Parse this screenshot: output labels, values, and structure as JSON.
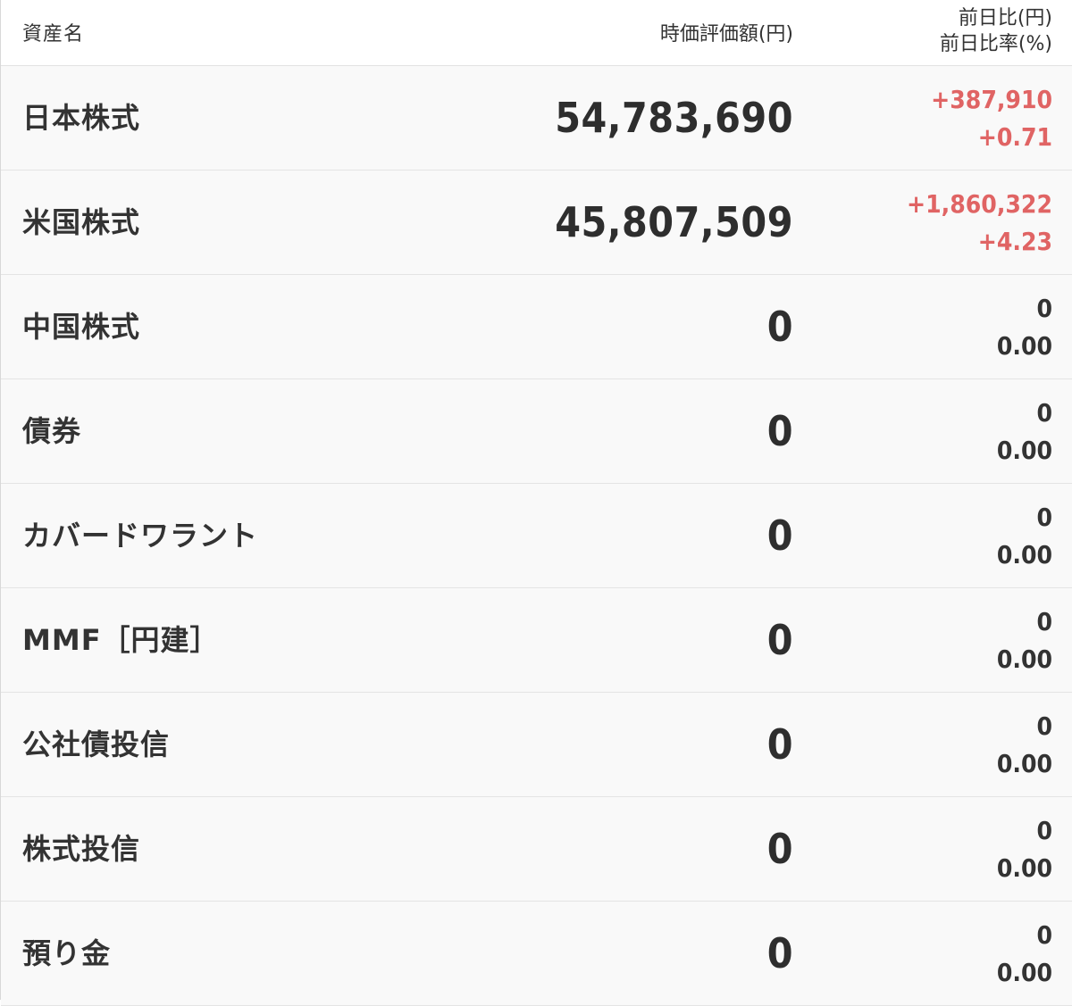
{
  "header": {
    "asset_name": "資産名",
    "market_value": "時価評価額(円)",
    "change_yen": "前日比(円)",
    "change_rate": "前日比率(%)"
  },
  "colors": {
    "positive": "#e06464",
    "neutral": "#333333",
    "row_bg": "#f9f9f9"
  },
  "rows": [
    {
      "name": "日本株式",
      "value": "54,783,690",
      "change": "+387,910",
      "rate": "+0.71",
      "trend": "pos"
    },
    {
      "name": "米国株式",
      "value": "45,807,509",
      "change": "+1,860,322",
      "rate": "+4.23",
      "trend": "pos"
    },
    {
      "name": "中国株式",
      "value": "0",
      "change": "0",
      "rate": "0.00",
      "trend": "flat"
    },
    {
      "name": "債券",
      "value": "0",
      "change": "0",
      "rate": "0.00",
      "trend": "flat"
    },
    {
      "name": "カバードワラント",
      "value": "0",
      "change": "0",
      "rate": "0.00",
      "trend": "flat"
    },
    {
      "name": "MMF［円建］",
      "value": "0",
      "change": "0",
      "rate": "0.00",
      "trend": "flat"
    },
    {
      "name": "公社債投信",
      "value": "0",
      "change": "0",
      "rate": "0.00",
      "trend": "flat"
    },
    {
      "name": "株式投信",
      "value": "0",
      "change": "0",
      "rate": "0.00",
      "trend": "flat"
    },
    {
      "name": "預り金",
      "value": "0",
      "change": "0",
      "rate": "0.00",
      "trend": "flat"
    }
  ]
}
